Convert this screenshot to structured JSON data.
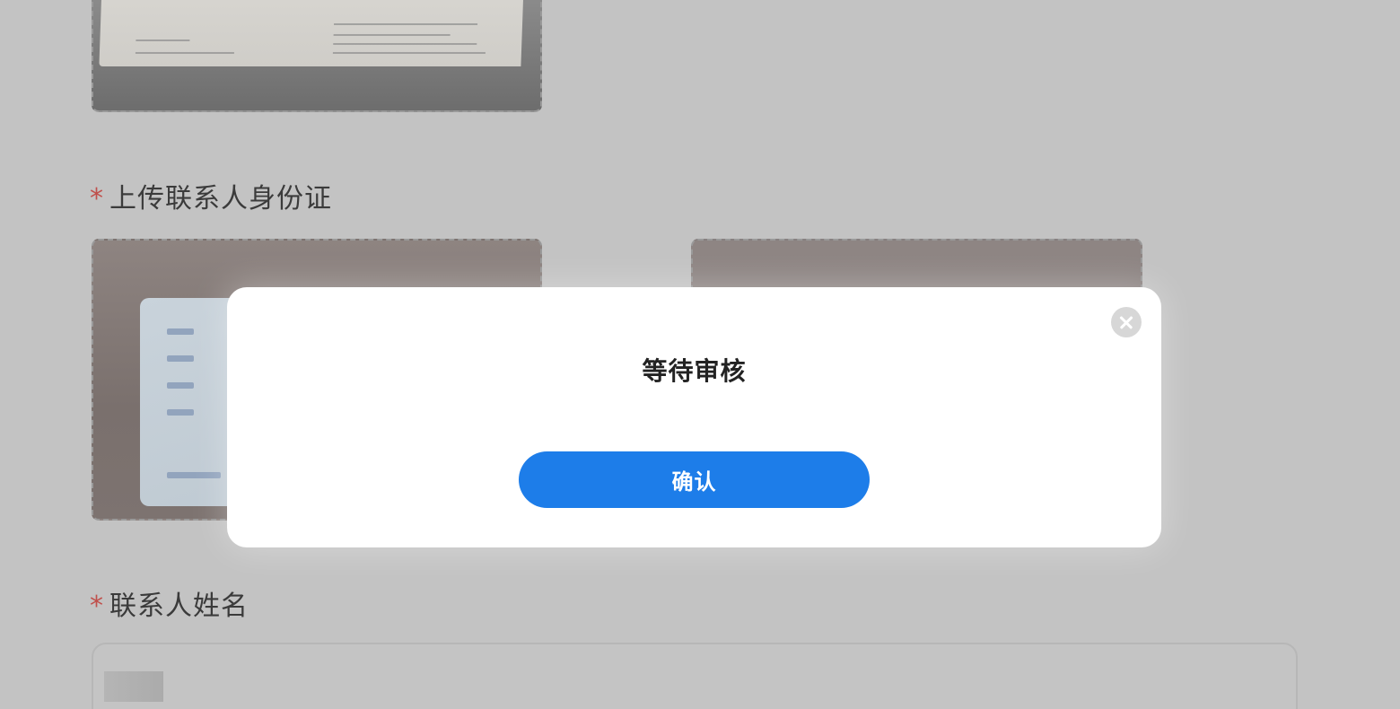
{
  "form": {
    "required_mark": "*",
    "id_upload_label": "上传联系人身份证",
    "contact_name_label": "联系人姓名"
  },
  "modal": {
    "title": "等待审核",
    "confirm_label": "确认"
  },
  "colors": {
    "primary": "#1d7de9",
    "required": "#c0504c",
    "overlay": "#c3c3c3"
  }
}
